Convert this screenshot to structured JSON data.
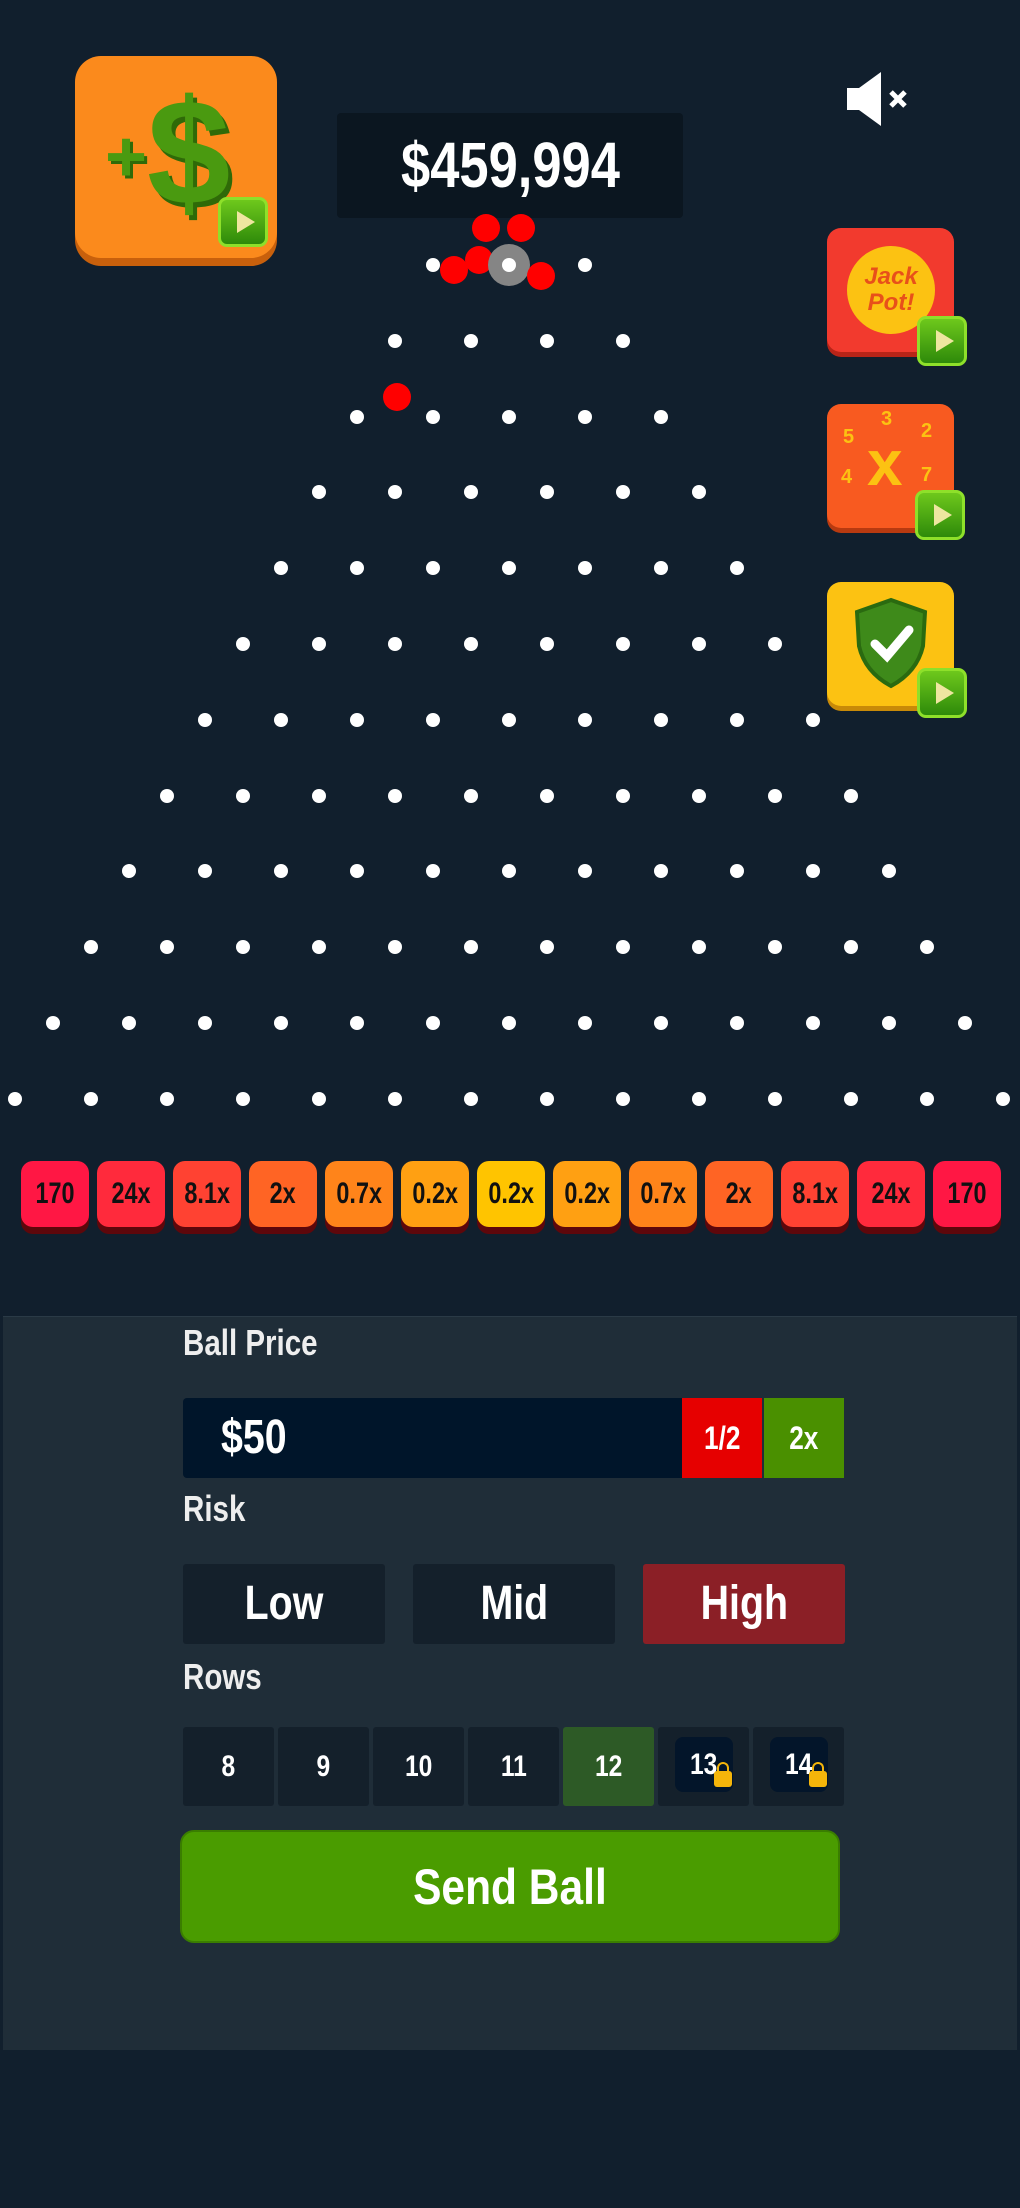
{
  "balance": "$459,994",
  "icons": {
    "add_money": "dollar-plus-icon",
    "mute": "speaker-muted-icon",
    "jackpot": "jackpot-icon",
    "multiplier": "multiplier-x-icon",
    "shield": "shield-check-icon",
    "play": "play-icon",
    "lock": "lock-icon"
  },
  "add_money": {
    "symbol": "$",
    "plus": "+"
  },
  "jackpot": {
    "label_line1": "Jack",
    "label_line2": "Pot!"
  },
  "multiplier_icon": {
    "x": "x",
    "numbers": [
      "5",
      "3",
      "2",
      "4",
      "7"
    ]
  },
  "board": {
    "rows": 12
  },
  "multipliers": [
    {
      "label": "170",
      "color": "#ff1744"
    },
    {
      "label": "24x",
      "color": "#ff2a3c"
    },
    {
      "label": "8.1x",
      "color": "#ff4232"
    },
    {
      "label": "2x",
      "color": "#ff6424"
    },
    {
      "label": "0.7x",
      "color": "#ff841a"
    },
    {
      "label": "0.2x",
      "color": "#ffa012"
    },
    {
      "label": "0.2x",
      "color": "#ffc400"
    },
    {
      "label": "0.2x",
      "color": "#ffa012"
    },
    {
      "label": "0.7x",
      "color": "#ff841a"
    },
    {
      "label": "2x",
      "color": "#ff6424"
    },
    {
      "label": "8.1x",
      "color": "#ff4232"
    },
    {
      "label": "24x",
      "color": "#ff2a3c"
    },
    {
      "label": "170",
      "color": "#ff1744"
    }
  ],
  "controls": {
    "ball_price_label": "Ball Price",
    "ball_price_value": "$50",
    "half_label": "1/2",
    "double_label": "2x",
    "risk_label": "Risk",
    "risk_options": [
      "Low",
      "Mid",
      "High"
    ],
    "risk_selected": "High",
    "rows_label": "Rows",
    "rows_options": [
      "8",
      "9",
      "10",
      "11",
      "12",
      "13",
      "14"
    ],
    "rows_selected": "12",
    "rows_locked": [
      "13",
      "14"
    ],
    "send_label": "Send Ball"
  },
  "colors": {
    "background": "#111f2d",
    "panel": "#1f2d38",
    "selected_risk": "#8b1f26",
    "selected_row": "#2d5a26",
    "send": "#4a9c00",
    "half": "#e60000",
    "double": "#4a9000"
  }
}
